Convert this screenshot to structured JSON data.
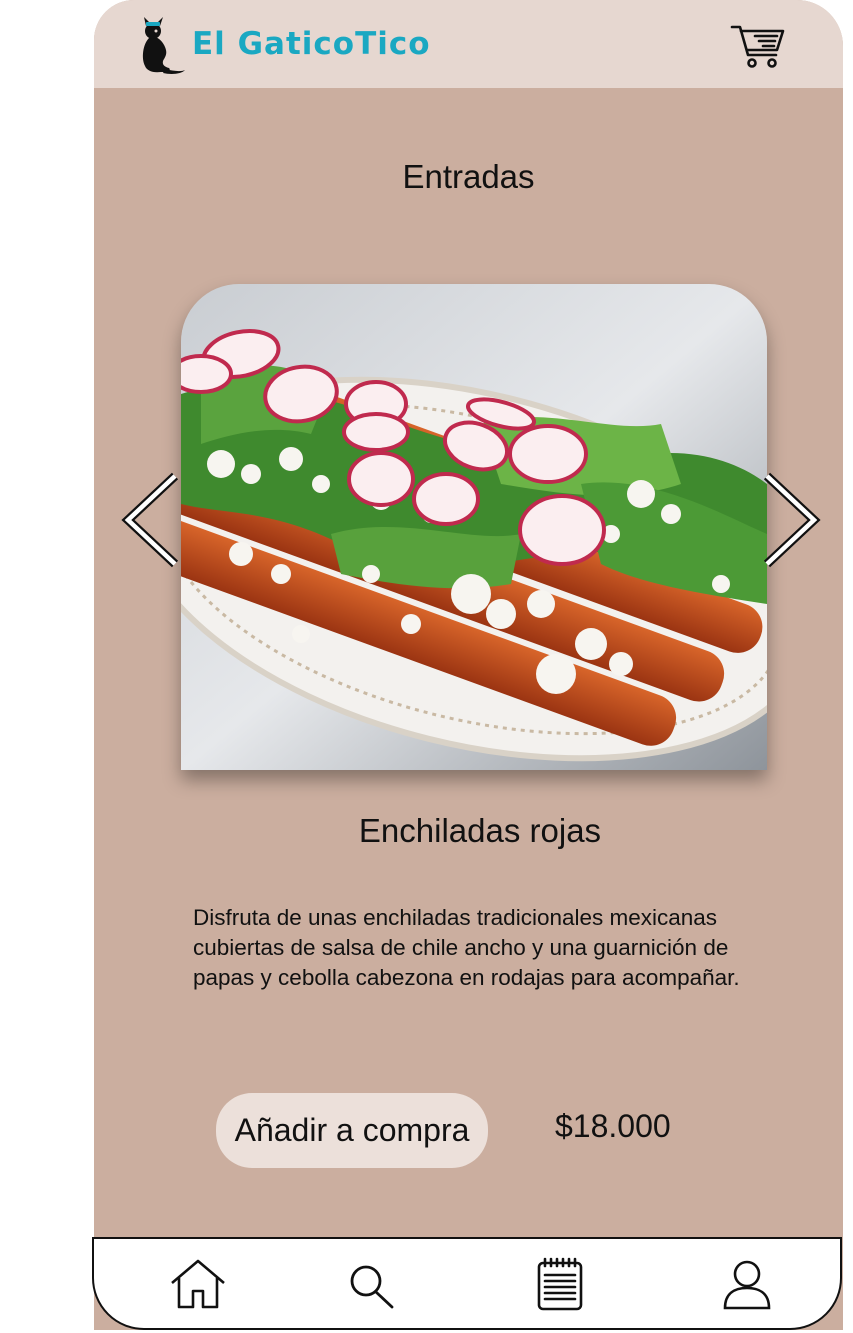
{
  "brand": {
    "name": "El GaticoTico",
    "color": "#1aa8c2"
  },
  "colors": {
    "background": "#cbae9f",
    "topbar": "#e6d7d0",
    "button": "#ece0da"
  },
  "header": {
    "cart_icon": "cart-icon"
  },
  "category": {
    "title": "Entradas"
  },
  "carousel": {
    "prev_icon": "chevron-left-icon",
    "next_icon": "chevron-right-icon"
  },
  "product": {
    "name": "Enchiladas rojas",
    "description": "Disfruta de unas enchiladas tradicionales mexicanas cubiertas de salsa de chile ancho y una guarnición de papas y cebolla cabezona en rodajas para acompañar.",
    "add_label": "Añadir a compra",
    "price": "$18.000"
  },
  "bottom_nav": {
    "items": [
      {
        "icon": "home-icon"
      },
      {
        "icon": "search-icon"
      },
      {
        "icon": "menu-notepad-icon"
      },
      {
        "icon": "user-icon"
      }
    ]
  }
}
